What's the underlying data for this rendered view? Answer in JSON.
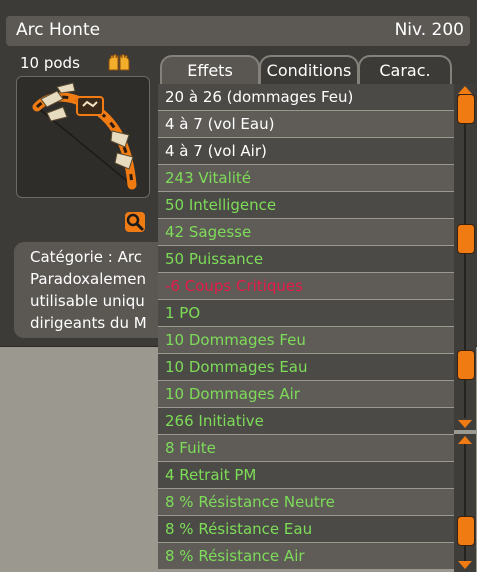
{
  "item": {
    "name": "Arc Honte",
    "level": "Niv. 200",
    "pods": "10 pods",
    "hands_icon": "two-hands-icon",
    "description_lines": [
      "Catégorie : Arc",
      "Paradoxalemen",
      "utilisable uniqu",
      "dirigeants du M"
    ]
  },
  "tabs": [
    {
      "label": "Effets",
      "active": true
    },
    {
      "label": "Conditions",
      "active": false
    },
    {
      "label": "Carac.",
      "active": false
    }
  ],
  "colors": {
    "positive": "#7ddc58",
    "negative": "#e41b48",
    "neutral": "#ffffff",
    "accent": "#f07b13"
  },
  "effects": [
    {
      "text": "20 à 26 (dommages Feu)",
      "type": "neutral"
    },
    {
      "text": "4 à 7 (vol Eau)",
      "type": "neutral"
    },
    {
      "text": "4 à 7 (vol Air)",
      "type": "neutral"
    },
    {
      "text": "243 Vitalité",
      "type": "positive"
    },
    {
      "text": "50 Intelligence",
      "type": "positive"
    },
    {
      "text": "42 Sagesse",
      "type": "positive"
    },
    {
      "text": "50 Puissance",
      "type": "positive"
    },
    {
      "text": "-6 Coups Critiques",
      "type": "negative"
    },
    {
      "text": "1 PO",
      "type": "positive"
    },
    {
      "text": "10 Dommages Feu",
      "type": "positive"
    },
    {
      "text": "10 Dommages Eau",
      "type": "positive"
    },
    {
      "text": "10 Dommages Air",
      "type": "positive"
    },
    {
      "text": "266 Initiative",
      "type": "positive"
    },
    {
      "text": "8 Fuite",
      "type": "positive"
    },
    {
      "text": "4 Retrait PM",
      "type": "positive"
    },
    {
      "text": "8 % Résistance Neutre",
      "type": "positive"
    },
    {
      "text": "8 % Résistance Eau",
      "type": "positive"
    },
    {
      "text": "8 % Résistance Air",
      "type": "positive"
    }
  ]
}
